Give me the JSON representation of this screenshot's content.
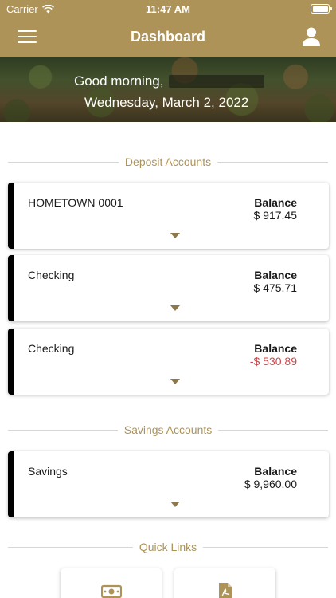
{
  "status_bar": {
    "carrier": "Carrier",
    "time": "11:47 AM",
    "icons": [
      "wifi-icon",
      "battery-icon"
    ]
  },
  "nav": {
    "title": "Dashboard",
    "icons": [
      "hamburger-menu-icon",
      "user-profile-icon"
    ]
  },
  "greeting": {
    "text": "Good morning,",
    "date": "Wednesday, March 2, 2022"
  },
  "deposit": {
    "header": "Deposit Accounts",
    "accounts": [
      {
        "name": "HOMETOWN 0001",
        "balance_label": "Balance",
        "balance": "$ 917.45"
      },
      {
        "name": "Checking",
        "balance_label": "Balance",
        "balance": "$ 475.71"
      },
      {
        "name": "Checking",
        "balance_label": "Balance",
        "balance": "-$ 530.89"
      }
    ]
  },
  "savings": {
    "header": "Savings Accounts",
    "accounts": [
      {
        "name": "Savings",
        "balance_label": "Balance",
        "balance": "$ 9,960.00"
      }
    ]
  },
  "quick_links": {
    "header": "Quick Links",
    "items": [
      {
        "icon": "money-transfer-icon"
      },
      {
        "icon": "document-pdf-icon"
      }
    ]
  },
  "colors": {
    "brand": "#ad9358",
    "negative": "#d0464a",
    "card_accent": "#000000"
  }
}
